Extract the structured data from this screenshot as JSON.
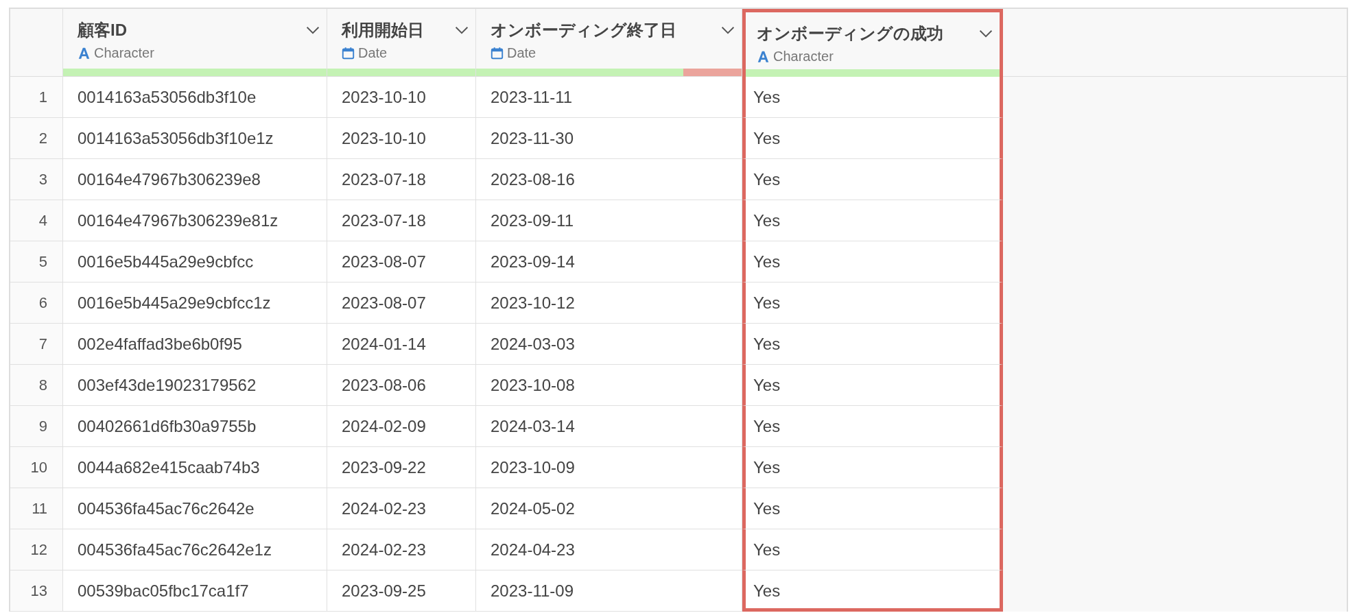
{
  "table": {
    "columns": [
      {
        "title": "顧客ID",
        "type": "Character",
        "kind": "character",
        "level": 1,
        "highlighted": false
      },
      {
        "title": "利用開始日",
        "type": "Date",
        "kind": "date",
        "level": 1,
        "highlighted": false
      },
      {
        "title": "オンボーディング終了日",
        "type": "Date",
        "kind": "date",
        "level": 0.78,
        "highlighted": false
      },
      {
        "title": "オンボーディングの成功",
        "type": "Character",
        "kind": "character",
        "level": 1,
        "highlighted": true
      }
    ],
    "rows": [
      {
        "number": "1",
        "cells": [
          "0014163a53056db3f10e",
          "2023-10-10",
          "2023-11-11",
          "Yes"
        ]
      },
      {
        "number": "2",
        "cells": [
          "0014163a53056db3f10e1z",
          "2023-10-10",
          "2023-11-30",
          "Yes"
        ]
      },
      {
        "number": "3",
        "cells": [
          "00164e47967b306239e8",
          "2023-07-18",
          "2023-08-16",
          "Yes"
        ]
      },
      {
        "number": "4",
        "cells": [
          "00164e47967b306239e81z",
          "2023-07-18",
          "2023-09-11",
          "Yes"
        ]
      },
      {
        "number": "5",
        "cells": [
          "0016e5b445a29e9cbfcc",
          "2023-08-07",
          "2023-09-14",
          "Yes"
        ]
      },
      {
        "number": "6",
        "cells": [
          "0016e5b445a29e9cbfcc1z",
          "2023-08-07",
          "2023-10-12",
          "Yes"
        ]
      },
      {
        "number": "7",
        "cells": [
          "002e4faffad3be6b0f95",
          "2024-01-14",
          "2024-03-03",
          "Yes"
        ]
      },
      {
        "number": "8",
        "cells": [
          "003ef43de19023179562",
          "2023-08-06",
          "2023-10-08",
          "Yes"
        ]
      },
      {
        "number": "9",
        "cells": [
          "00402661d6fb30a9755b",
          "2024-02-09",
          "2024-03-14",
          "Yes"
        ]
      },
      {
        "number": "10",
        "cells": [
          "0044a682e415caab74b3",
          "2023-09-22",
          "2023-10-09",
          "Yes"
        ]
      },
      {
        "number": "11",
        "cells": [
          "004536fa45ac76c2642e",
          "2024-02-23",
          "2024-05-02",
          "Yes"
        ]
      },
      {
        "number": "12",
        "cells": [
          "004536fa45ac76c2642e1z",
          "2024-02-23",
          "2024-04-23",
          "Yes"
        ]
      },
      {
        "number": "13",
        "cells": [
          "00539bac05fbc17ca1f7",
          "2023-09-25",
          "2023-11-09",
          "Yes"
        ]
      }
    ]
  }
}
